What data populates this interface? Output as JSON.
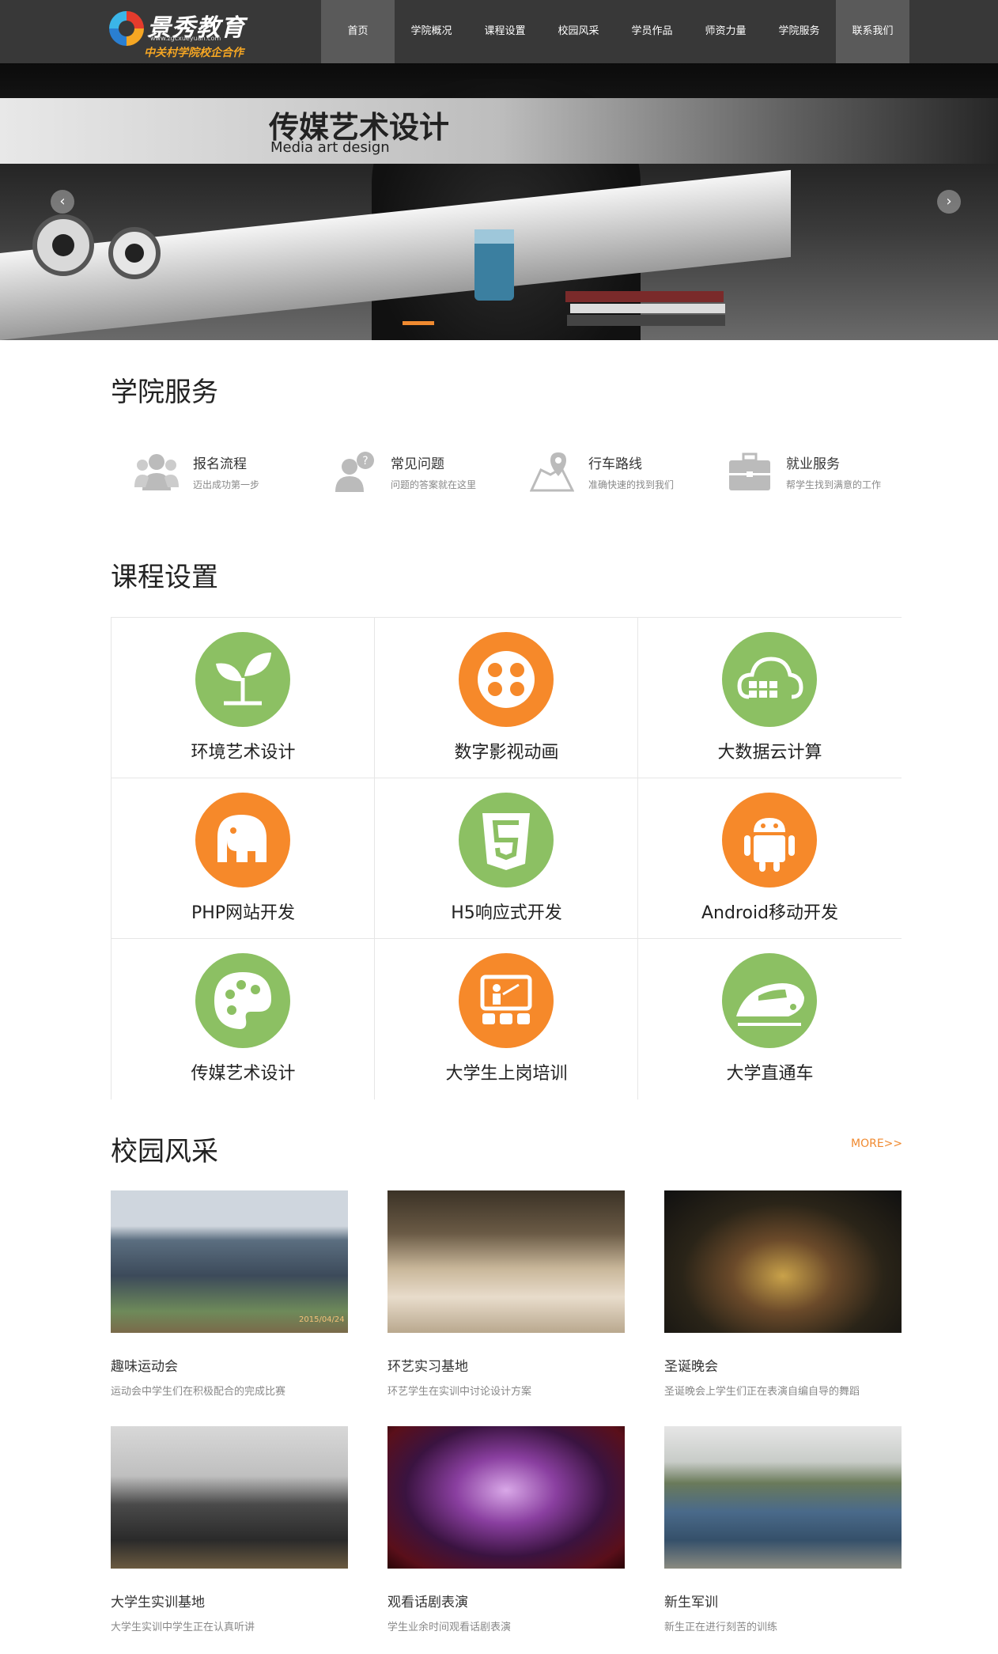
{
  "header": {
    "logo_main": "景秀教育",
    "logo_url": "www.zgcxueyuan.com",
    "logo_sub": "中关村学院校企合作",
    "nav": [
      {
        "label": "首页",
        "active": true
      },
      {
        "label": "学院概况",
        "active": false
      },
      {
        "label": "课程设置",
        "active": false
      },
      {
        "label": "校园风采",
        "active": false
      },
      {
        "label": "学员作品",
        "active": false
      },
      {
        "label": "师资力量",
        "active": false
      },
      {
        "label": "学院服务",
        "active": false
      },
      {
        "label": "联系我们",
        "active": true
      }
    ]
  },
  "banner": {
    "title": "传媒艺术设计",
    "subtitle": "Media art design",
    "prev_symbol": "‹",
    "next_symbol": "›"
  },
  "services": {
    "title": "学院服务",
    "items": [
      {
        "title": "报名流程",
        "desc": "迈出成功第一步",
        "icon": "users-icon"
      },
      {
        "title": "常见问题",
        "desc": "问题的答案就在这里",
        "icon": "question-user-icon"
      },
      {
        "title": "行车路线",
        "desc": "准确快速的找到我们",
        "icon": "map-pin-icon"
      },
      {
        "title": "就业服务",
        "desc": "帮学生找到满意的工作",
        "icon": "briefcase-icon"
      }
    ]
  },
  "courses": {
    "title": "课程设置",
    "items": [
      {
        "label": "环境艺术设计",
        "color": "#8cc063",
        "icon": "sprout-icon"
      },
      {
        "label": "数字影视动画",
        "color": "#f6892a",
        "icon": "film-reel-icon"
      },
      {
        "label": "大数据云计算",
        "color": "#8cc063",
        "icon": "cloud-icon"
      },
      {
        "label": "PHP网站开发",
        "color": "#f6892a",
        "icon": "elephant-icon"
      },
      {
        "label": "H5响应式开发",
        "color": "#8cc063",
        "icon": "html5-icon"
      },
      {
        "label": "Android移动开发",
        "color": "#f6892a",
        "icon": "android-icon"
      },
      {
        "label": "传媒艺术设计",
        "color": "#8cc063",
        "icon": "palette-icon"
      },
      {
        "label": "大学生上岗培训",
        "color": "#f6892a",
        "icon": "classroom-icon"
      },
      {
        "label": "大学直通车",
        "color": "#8cc063",
        "icon": "train-icon"
      }
    ]
  },
  "campus": {
    "title": "校园风采",
    "more": "MORE>>",
    "items": [
      {
        "title": "趣味运动会",
        "desc": "运动会中学生们在积极配合的完成比赛",
        "photo_date": "2015/04/24"
      },
      {
        "title": "环艺实习基地",
        "desc": "环艺学生在实训中讨论设计方案"
      },
      {
        "title": "圣诞晚会",
        "desc": "圣诞晚会上学生们正在表演自编自导的舞蹈"
      },
      {
        "title": "大学生实训基地",
        "desc": "大学生实训中学生正在认真听讲"
      },
      {
        "title": "观看话剧表演",
        "desc": "学生业余时间观看话剧表演"
      },
      {
        "title": "新生军训",
        "desc": "新生正在进行刻苦的训练"
      }
    ]
  }
}
